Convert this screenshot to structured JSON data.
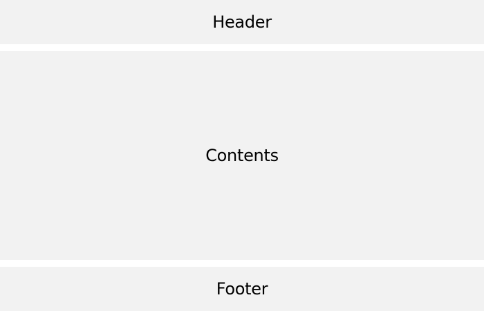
{
  "layout": {
    "header": {
      "label": "Header"
    },
    "contents": {
      "label": "Contents"
    },
    "footer": {
      "label": "Footer"
    }
  },
  "colors": {
    "panel_background": "#f2f2f2",
    "page_background": "#ffffff",
    "text": "#000000"
  }
}
